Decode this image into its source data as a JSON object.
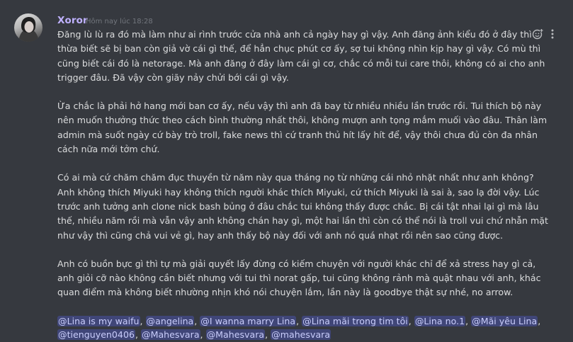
{
  "message": {
    "author": "Xoror",
    "timestamp": "Hôm nay lúc 18:28",
    "author_color": "#bfb1ff",
    "paragraphs": [
      "Đăng lù lù ra đó mà làm như ai rình trước cửa nhà anh cả ngày hay gì vậy. Anh đăng ảnh kiểu đó ở đây thì thừa biết sẽ bị ban còn giả vờ cái gì thế, để hẳn chục phút cơ ấy, sợ tui không nhìn kịp hay gì vậy. Có mù thì cũng biết cái đó là netorage. Mà anh đăng ở đây làm cái gì cơ, chắc có mỗi tui care thôi, không có ai cho anh trigger đâu. Đã vậy còn giãy nảy chửi bới cái gì vậy.",
      "Ừa chắc là phải hở hang mới ban cơ ấy, nếu vậy thì anh đã bay từ nhiều nhiều lần trước rồi.  Tui thích bộ này nên muốn thưởng thức theo cách bình thường nhất thôi, không mượn anh tọng mắm muối vào đâu. Thân làm admin mà suốt ngày cứ bày trò troll, fake news thì cứ tranh thủ hít lấy hít để,  vậy thôi chưa đủ còn đa nhân cách nữa mới tởm chứ.",
      "Có ai mà cứ chăm chăm đục thuyền từ năm này qua tháng nọ từ những cái nhỏ nhặt nhất như anh không? Anh không thích Miyuki hay không thích người khác thích Miyuki, cứ thích Miyuki là sai à, sao lạ đời vậy. Lúc trước anh tưởng anh clone nick bash bủng ở đâu chắc tui không thấy được chắc. Bị cái tật nhai lại gì mà lâu thế, nhiều năm rồi mà vẫn vậy anh không chán hay gì, một hai lần thì còn có thể nói là troll vui chứ nhẫn mặt như vậy thì cũng chả vui vẻ gì, hay anh thấy bộ này đối với anh nó quá nhạt rồi nên sao cũng được.",
      "Anh có buồn bực gì thì tự mà giải quyết lấy đừng có kiếm chuyện với người khác chỉ để xả stress hay gì cả, anh giỏi cỡ nào không cần biết nhưng với tui thì norat gấp, tui cũng không rảnh mà quật nhau với anh, khác quan điểm mà không biết nhường nhịn khó nói chuyện lắm, lần này là goodbye thật sự nhé, no arrow."
    ],
    "mentions": [
      "@Lina is my waifu",
      "@angelina",
      "@I wanna marry Lina",
      "@Lina mãi trong tim tôi",
      "@Lina no.1",
      "@Mãi yêu Lina",
      "@tienguyen0406",
      "@Mahesvara",
      "@Mahesvara",
      "@mahesvara"
    ],
    "mention_separator": ", "
  },
  "actions": {
    "add_reaction_icon": "emoji-add-icon",
    "more_icon": "more-options-icon"
  },
  "colors": {
    "background": "#36393f",
    "text": "#dcddde",
    "mention_bg": "#414675",
    "mention_text": "#c9cdfb",
    "timestamp": "#72767d"
  }
}
